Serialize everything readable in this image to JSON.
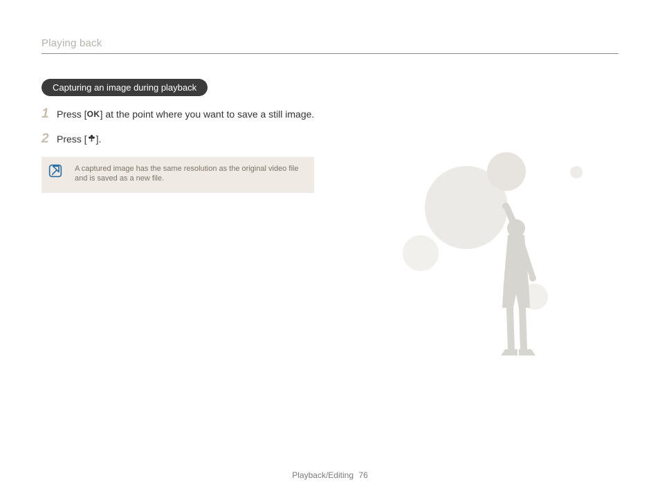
{
  "header": {
    "title": "Playing back"
  },
  "section": {
    "pill": "Capturing an image during playback"
  },
  "steps": [
    {
      "num": "1",
      "pre": "Press [",
      "icon_name": "ok-icon",
      "post": "] at the point where you want to save a still image."
    },
    {
      "num": "2",
      "pre": "Press [",
      "icon_name": "macro-flower-icon",
      "post": "]."
    }
  ],
  "note": {
    "icon_name": "note-icon",
    "text": "A captured image has the same resolution as the original video file and is saved as a new file."
  },
  "footer": {
    "section": "Playback/Editing",
    "page": "76"
  },
  "colors": {
    "pill_bg": "#3b3b3b",
    "note_bg": "#efeae4",
    "step_num": "#c6bfae",
    "header_title": "#b6b2ac",
    "art_fill": "#d7d5d0",
    "note_icon": "#2e6fa3"
  }
}
